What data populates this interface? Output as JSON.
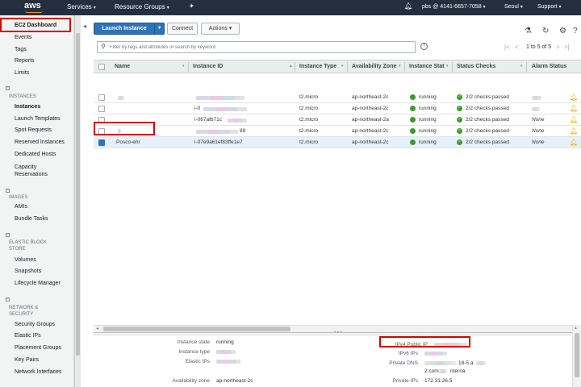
{
  "topnav": {
    "logo": "aws",
    "services": "Services",
    "resource_groups": "Resource Groups",
    "account": "pbs @ 4141-6657-7058",
    "region": "Seoul",
    "support": "Support"
  },
  "sidebar": {
    "top_items": [
      "EC2 Dashboard",
      "Events",
      "Tags",
      "Reports",
      "Limits"
    ],
    "sections": [
      {
        "title": "INSTANCES",
        "items": [
          "Instances",
          "Launch Templates",
          "Spot Requests",
          "Reserved Instances",
          "Dedicated Hosts",
          "Capacity Reservations"
        ]
      },
      {
        "title": "IMAGES",
        "items": [
          "AMIs",
          "Bundle Tasks"
        ]
      },
      {
        "title": "ELASTIC BLOCK STORE",
        "items": [
          "Volumes",
          "Snapshots",
          "Lifecycle Manager"
        ]
      },
      {
        "title": "NETWORK & SECURITY",
        "items": [
          "Security Groups",
          "Elastic IPs",
          "Placement Groups",
          "Key Pairs",
          "Network Interfaces"
        ]
      }
    ]
  },
  "toolbar": {
    "launch_instance": "Launch Instance",
    "connect": "Connect",
    "actions": "Actions"
  },
  "search": {
    "placeholder": "Filter by tags and attributes or search by keyword"
  },
  "pager": {
    "text": "1 to 5 of 5"
  },
  "table": {
    "columns": [
      "Name",
      "Instance ID",
      "Instance Type",
      "Availability Zone",
      "Instance Stat",
      "Status Checks",
      "Alarm Status"
    ],
    "rows": [
      {
        "name": "",
        "id": "",
        "type": "t2.micro",
        "az": "ap-northeast-2c",
        "state": "running",
        "checks": "2/2 checks passed",
        "alarm": ""
      },
      {
        "name": "",
        "id": "i-0",
        "type": "t2.micro",
        "az": "ap-northeast-2c",
        "state": "running",
        "checks": "2/2 checks passed",
        "alarm": ""
      },
      {
        "name": "",
        "id": "i-067afb71c",
        "type": "t2.micro",
        "az": "ap-northeast-2a",
        "state": "running",
        "checks": "2/2 checks passed",
        "alarm": "None"
      },
      {
        "name": "",
        "id": "89",
        "type": "t2.micro",
        "az": "ap-northeast-2c",
        "state": "running",
        "checks": "2/2 checks passed",
        "alarm": "None"
      },
      {
        "name": "Posco-ehr",
        "id": "i-07e9a61ef83ffe1e7",
        "type": "t2.micro",
        "az": "ap-northeast-2c",
        "state": "running",
        "checks": "2/2 checks passed",
        "alarm": "None"
      }
    ]
  },
  "details": {
    "instance_state_label": "Instance state",
    "instance_state_value": "running",
    "instance_type_label": "Instance type",
    "elastic_ips_label": "Elastic IPs",
    "availability_zone_label": "Availability zone",
    "availability_zone_value": "ap-northeast-2c",
    "ipv4_public_ip_label": "IPv4 Public IP",
    "ipv6_ips_label": "IPv6 IPs",
    "private_dns_label": "Private DNS",
    "private_dns_value_1": "18-5.a",
    "private_dns_value_2": "2.com",
    "private_dns_value_3": "nterna",
    "private_ips_label": "Private IPs",
    "private_ips_value": "172.31.26.5"
  },
  "colors": {
    "nav_bg": "#232f3e",
    "primary": "#2e73b8",
    "running": "#3a9b2b",
    "highlight": "#d50000"
  }
}
